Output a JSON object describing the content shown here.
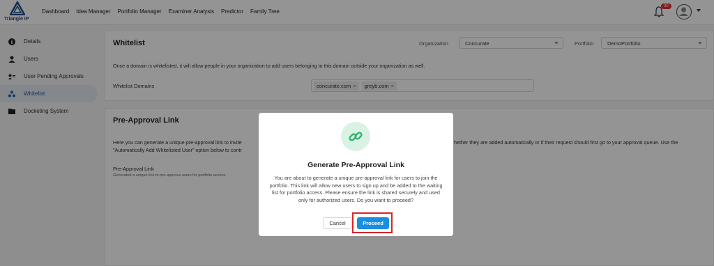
{
  "brand": {
    "name": "Triangle IP"
  },
  "nav": [
    "Dashboard",
    "Idea Manager",
    "Portfolio Manager",
    "Examiner Analysis",
    "Predictor",
    "Family Tree"
  ],
  "notifications": {
    "count": "30"
  },
  "sidebar": {
    "items": [
      {
        "label": "Details",
        "icon": "info-icon"
      },
      {
        "label": "Users",
        "icon": "user-icon"
      },
      {
        "label": "User Pending Approvals",
        "icon": "user-pending-icon"
      },
      {
        "label": "Whitelist",
        "icon": "whitelist-icon"
      },
      {
        "label": "Docketing System",
        "icon": "folder-icon"
      }
    ],
    "active": "Whitelist"
  },
  "whitelist": {
    "title": "Whitelist",
    "organization_label": "Organization",
    "organization_value": "Concurate",
    "portfolio_label": "Portfolio",
    "portfolio_value": "DemoPortfolio",
    "description": "Once a domain is whitelisted, it will allow people in your organization to add users belonging to this domain outside your organization as well.",
    "domains_label": "Whitelist Domains",
    "domains": [
      "concurate.com",
      "greyb.com"
    ]
  },
  "preapproval": {
    "title": "Pre-Approval Link",
    "desc_line1_left": "Here you can generate a unique pre-approval link to invite",
    "desc_line1_right": "hether they are added automatically or if their request should first go to your approval queue. Use the",
    "desc_line2_left": "\"Automatically Add Whitelisted User\" option below to contr",
    "link_label": "Pre-Approval Link",
    "link_sub": "Generated a unique link to pre-approve users for portfolio access."
  },
  "modal": {
    "title": "Generate Pre-Approval Link",
    "body": "You are about to generate a unique pre-approval link for users to join the portfolio. This link will allow new users to sign up and be added to the waiting list for portfolio access. Please ensure the link is shared securely and used only for authorized users. Do you want to proceed?",
    "cancel_label": "Cancel",
    "proceed_label": "Proceed"
  },
  "colors": {
    "accent": "#1b8ee0",
    "highlight": "#d9232c",
    "brand": "#1f4e8c"
  }
}
